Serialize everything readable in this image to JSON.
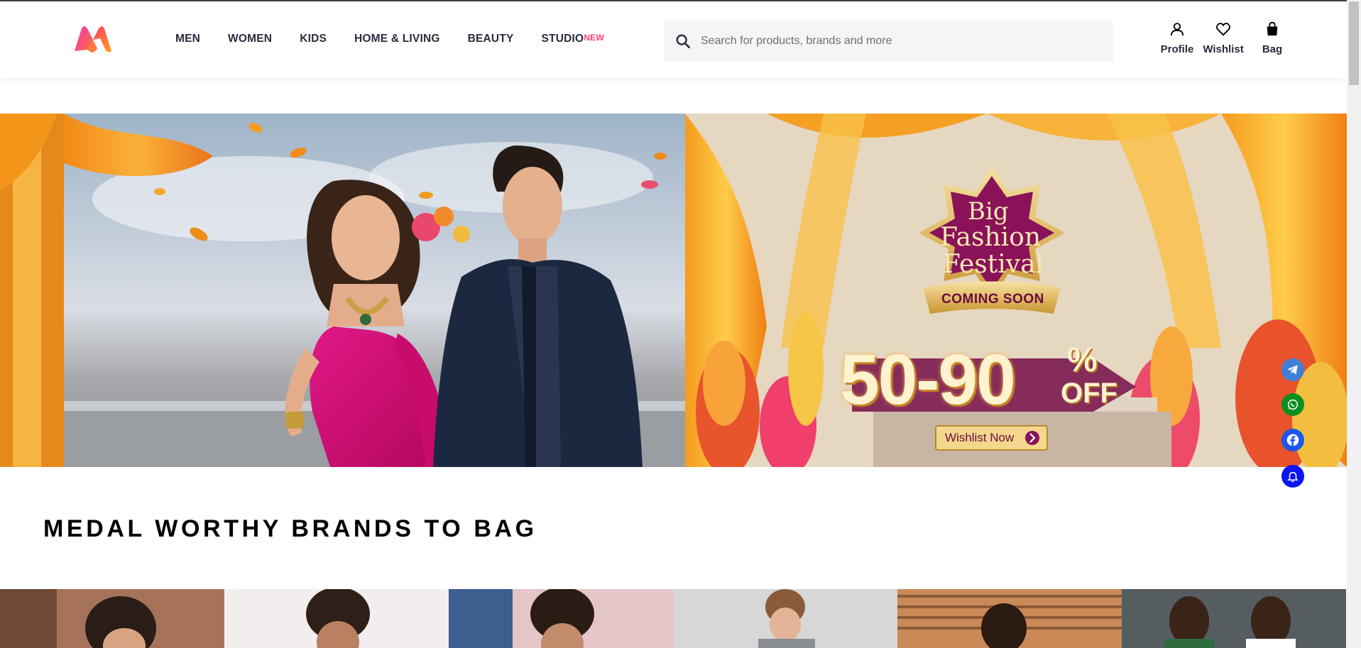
{
  "header": {
    "logo_alt": "Myntra",
    "nav": [
      {
        "label": "MEN"
      },
      {
        "label": "WOMEN"
      },
      {
        "label": "KIDS"
      },
      {
        "label": "HOME & LIVING"
      },
      {
        "label": "BEAUTY"
      },
      {
        "label": "STUDIO",
        "badge": "NEW"
      }
    ],
    "search": {
      "placeholder": "Search for products, brands and more",
      "icon": "search-icon"
    },
    "actions": [
      {
        "label": "Profile",
        "icon": "profile-icon"
      },
      {
        "label": "Wishlist",
        "icon": "heart-icon"
      },
      {
        "label": "Bag",
        "icon": "bag-icon"
      }
    ]
  },
  "banner": {
    "title_line1": "Big",
    "title_line2": "Fashion",
    "title_line3": "Festival",
    "ribbon": "COMING SOON",
    "discount": "50-90",
    "percent": "%",
    "off": "OFF",
    "cta": "Wishlist Now"
  },
  "social": [
    {
      "icon": "telegram-icon",
      "color": "#3f7fd6"
    },
    {
      "icon": "whatsapp-icon",
      "color": "#0b8f1f"
    },
    {
      "icon": "facebook-icon",
      "color": "#1b56f0"
    },
    {
      "icon": "bell-icon",
      "color": "#0a14f5"
    }
  ],
  "section": {
    "title": "MEDAL WORTHY BRANDS TO BAG"
  },
  "colors": {
    "accent": "#ff3f6c",
    "text": "#282c3f",
    "banner_pink": "#d8107a",
    "banner_orange": "#f08a1c"
  }
}
